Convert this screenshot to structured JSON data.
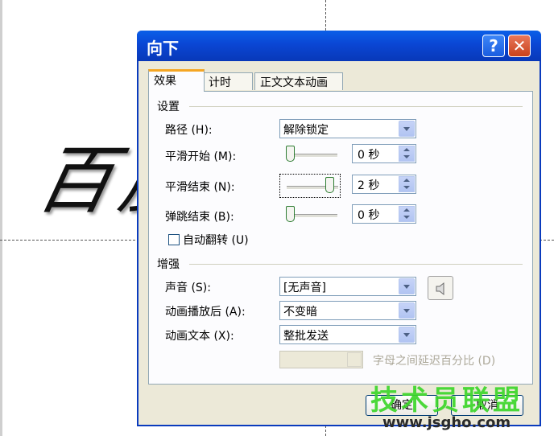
{
  "slide": {
    "calligraphy": "百度"
  },
  "dialog": {
    "title": "向下",
    "help_label": "?",
    "close_label": "✕",
    "tabs": [
      {
        "label": "效果"
      },
      {
        "label": "计时"
      },
      {
        "label": "正文文本动画"
      }
    ],
    "settings": {
      "group_title": "设置",
      "path_label": "路径 (H):",
      "path_value": "解除锁定",
      "smooth_start_label": "平滑开始 (M):",
      "smooth_start_value": "0 秒",
      "smooth_start_fraction": 0,
      "smooth_end_label": "平滑结束 (N):",
      "smooth_end_value": "2 秒",
      "smooth_end_fraction": 1,
      "bounce_end_label": "弹跳结束 (B):",
      "bounce_end_value": "0 秒",
      "bounce_end_fraction": 0,
      "auto_reverse_label": "自动翻转 (U)",
      "auto_reverse_checked": false
    },
    "enhancements": {
      "group_title": "增强",
      "sound_label": "声音 (S):",
      "sound_value": "[无声音]",
      "after_animation_label": "动画播放后 (A):",
      "after_animation_value": "不变暗",
      "animate_text_label": "动画文本 (X):",
      "animate_text_value": "整批发送",
      "letter_delay_label": "字母之间延迟百分比 (D)",
      "speaker_icon": "speaker-icon"
    },
    "buttons": {
      "ok": "确定",
      "cancel": "取消"
    }
  },
  "watermark": {
    "line1": "技术员联盟",
    "line2": "www.jsgho.com"
  },
  "colors": {
    "titlebar": "#0a46d4",
    "dialog_bg": "#ece9d8",
    "tab_accent": "#f5a623",
    "watermark_green": "#3dd62b"
  }
}
